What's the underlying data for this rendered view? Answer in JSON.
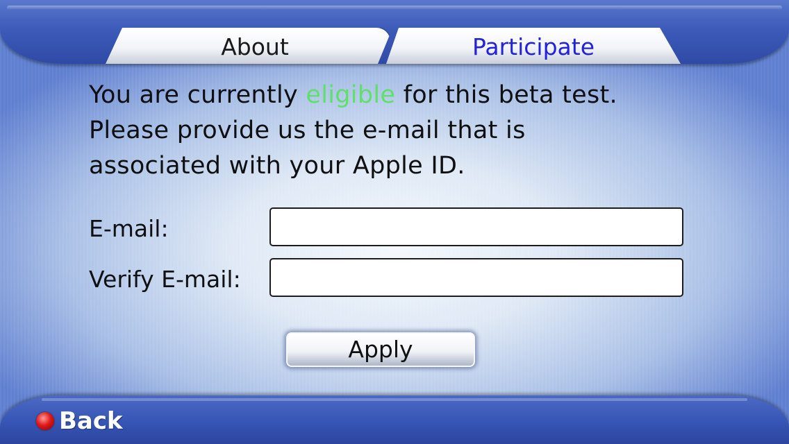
{
  "tabs": {
    "about_label": "About",
    "participate_label": "Participate",
    "active": "Participate"
  },
  "message": {
    "part1": "You are currently ",
    "eligible_word": "eligible",
    "part2": " for this beta test.",
    "line2": "Please provide us the e-mail that is",
    "line3": "associated with your Apple ID."
  },
  "form": {
    "email_label": "E-mail:",
    "email_value": "",
    "verify_label": "Verify E-mail:",
    "verify_value": "",
    "apply_label": "Apply"
  },
  "footer": {
    "back_label": "Back",
    "back_icon": "red-circle-icon"
  },
  "colors": {
    "eligible": "#5fe06a",
    "active_tab_text": "#2222dd",
    "chrome_blue": "#3d5bb9"
  }
}
